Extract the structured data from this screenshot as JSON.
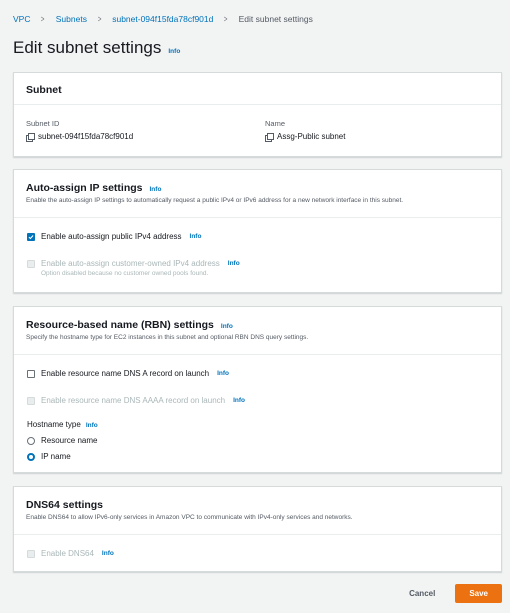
{
  "breadcrumb": {
    "items": [
      "VPC",
      "Subnets",
      "subnet-094f15fda78cf901d"
    ],
    "current": "Edit subnet settings"
  },
  "page": {
    "title": "Edit subnet settings",
    "info": "Info"
  },
  "subnet_card": {
    "title": "Subnet",
    "subnet_id_label": "Subnet ID",
    "subnet_id_value": "subnet-094f15fda78cf901d",
    "name_label": "Name",
    "name_value": "Assg-Public subnet"
  },
  "auto_assign": {
    "title": "Auto-assign IP settings",
    "info": "Info",
    "description": "Enable the auto-assign IP settings to automatically request a public IPv4 or IPv6 address for a new network interface in this subnet.",
    "ipv4_label": "Enable auto-assign public IPv4 address",
    "ipv4_checked": true,
    "coip_label": "Enable auto-assign customer-owned IPv4 address",
    "coip_note": "Option disabled because no customer owned pools found.",
    "coip_checked": false
  },
  "rbn": {
    "title": "Resource-based name (RBN) settings",
    "info": "Info",
    "description": "Specify the hostname type for EC2 instances in this subnet and optional RBN DNS query settings.",
    "dns_a_label": "Enable resource name DNS A record on launch",
    "dns_aaaa_label": "Enable resource name DNS AAAA record on launch",
    "hostname_label": "Hostname type",
    "hostname_options": [
      "Resource name",
      "IP name"
    ],
    "hostname_selected": "IP name"
  },
  "dns64": {
    "title": "DNS64 settings",
    "description": "Enable DNS64 to allow IPv6-only services in Amazon VPC to communicate with IPv4-only services and networks.",
    "enable_label": "Enable DNS64"
  },
  "actions": {
    "cancel": "Cancel",
    "save": "Save"
  },
  "colors": {
    "link": "#0073bb",
    "primary": "#ec7211",
    "checked": "#0073bb"
  }
}
